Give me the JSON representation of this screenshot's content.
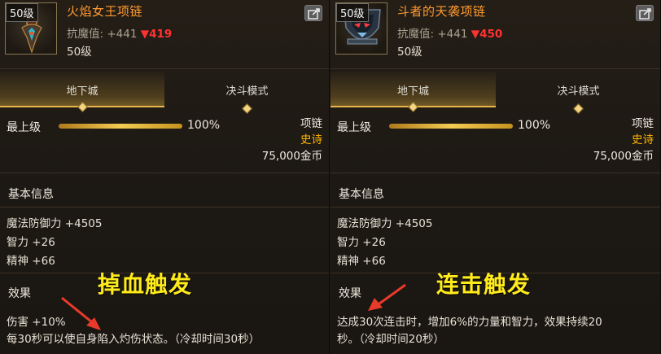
{
  "left": {
    "level_badge": "50级",
    "name": "火焰女王项链",
    "stat_label": "抗魔值: +441",
    "stat_delta": "▼419",
    "level_text": "50级",
    "tabs": [
      {
        "label": "地下城"
      },
      {
        "label": "决斗模式"
      }
    ],
    "grade_label": "最上级",
    "grade_percent_text": "100%",
    "grade_fill": 1.0,
    "slot_type": "项链",
    "rarity": "史诗",
    "price": "75,000金币",
    "basic_title": "基本信息",
    "stats": [
      "魔法防御力 +4505",
      "智力 +26",
      "精神 +66"
    ],
    "effect_title": "效果",
    "effect_lines": [
      "伤害 +10%",
      "每30秒可以使自身陷入灼伤状态。（冷却时间30秒）"
    ],
    "annotation": "掉血触发"
  },
  "right": {
    "level_badge": "50级",
    "name": "斗者的天袭项链",
    "stat_label": "抗魔值: +441",
    "stat_delta": "▼450",
    "level_text": "50级",
    "tabs": [
      {
        "label": "地下城"
      },
      {
        "label": "决斗模式"
      }
    ],
    "grade_label": "最上级",
    "grade_percent_text": "100%",
    "grade_fill": 1.0,
    "slot_type": "项链",
    "rarity": "史诗",
    "price": "75,000金币",
    "basic_title": "基本信息",
    "stats": [
      "魔法防御力 +4505",
      "智力 +26",
      "精神 +66"
    ],
    "effect_title": "效果",
    "effect_lines": [
      "达成30次连击时，增加6%的力量和智力，效果持续20",
      "秒。（冷却时间20秒）"
    ],
    "annotation": "连击触发"
  },
  "colors": {
    "item_name": "#ff9a2e",
    "delta_down": "#ff3232",
    "rarity_epic": "#ffb400",
    "annotation": "#ffeb1a",
    "arrow": "#e83a2a",
    "tab_accent": "#e7b54c"
  },
  "icons": {
    "share": "share-icon",
    "tab_gem": "diamond-gem-icon",
    "left_item": "flame-queen-necklace-icon",
    "right_item": "fighter-necklace-icon"
  }
}
